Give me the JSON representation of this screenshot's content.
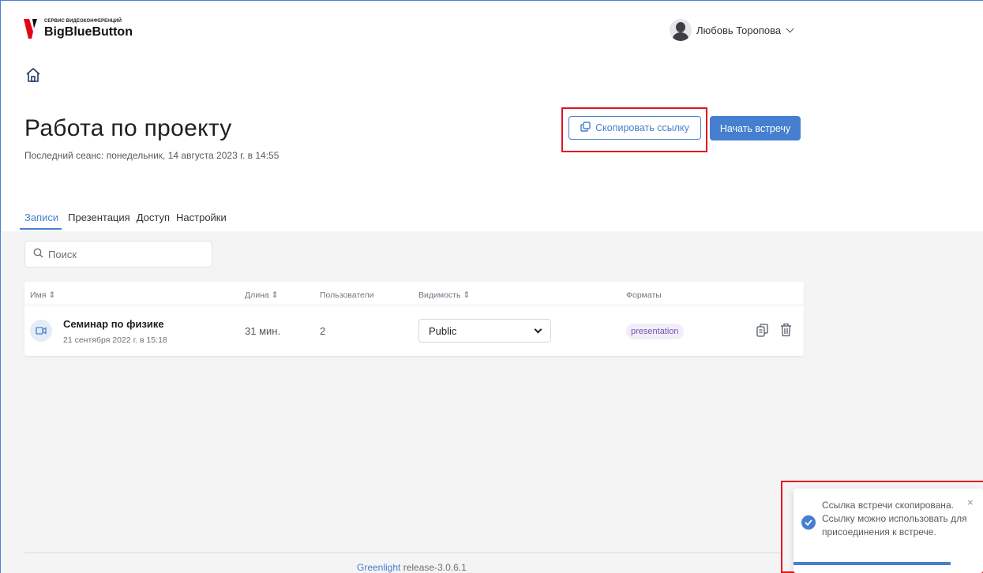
{
  "brand": {
    "tagline": "СЕРВИС ВИДЕОКОНФЕРЕНЦИЙ",
    "name": "BigBlueButton",
    "logo_colors": [
      "#e30613",
      "#111111"
    ]
  },
  "user": {
    "name": "Любовь Торопова"
  },
  "room": {
    "title": "Работа по проекту",
    "last_session": "Последний сеанс: понедельник, 14 августа 2023 г. в 14:55",
    "copy_link_label": "Скопировать ссылку",
    "start_meeting_label": "Начать встречу"
  },
  "tabs": [
    {
      "label": "Записи",
      "active": true
    },
    {
      "label": "Презентация",
      "active": false
    },
    {
      "label": "Доступ",
      "active": false
    },
    {
      "label": "Настройки",
      "active": false
    }
  ],
  "search": {
    "placeholder": "Поиск"
  },
  "table": {
    "headers": {
      "name": "Имя",
      "length": "Длина",
      "users": "Пользователи",
      "visibility": "Видимость",
      "formats": "Форматы"
    },
    "rows": [
      {
        "name": "Семинар по физике",
        "date": "21 сентября 2022 г. в 15:18",
        "length": "31 мин.",
        "users": "2",
        "visibility": "Public",
        "format": "presentation"
      }
    ]
  },
  "footer": {
    "link": "Greenlight",
    "release": " release-3.0.6.1"
  },
  "toast": {
    "message": "Ссылка встречи скопирована. Ссылку можно использовать для присоединения к встрече.",
    "close": "×",
    "progress": 0.83
  },
  "colors": {
    "accent": "#467fcf",
    "highlight": "#e1141f",
    "badge_text": "#7a51b8",
    "background_grey": "#f4f4f4"
  }
}
